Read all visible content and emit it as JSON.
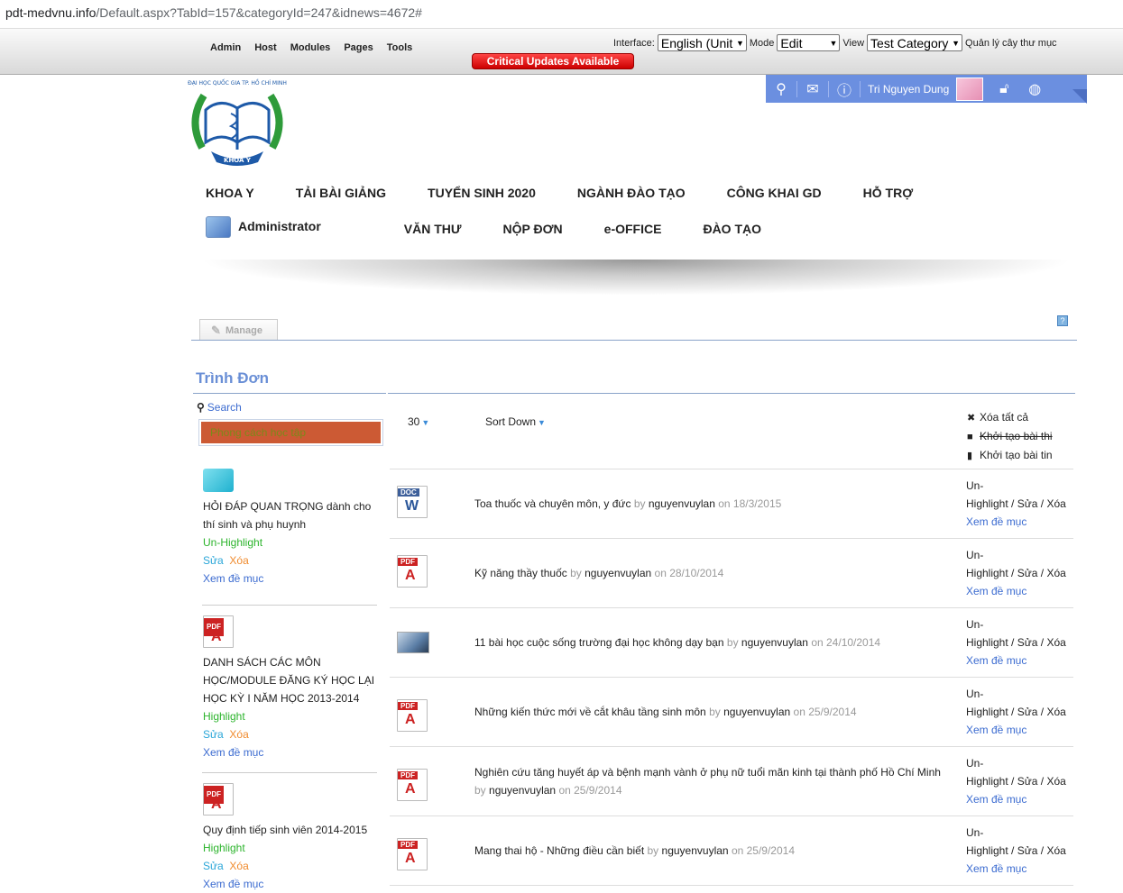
{
  "browser": {
    "url_host": "pdt-medvnu.info",
    "url_path": "/Default.aspx?TabId=157&categoryId=247&idnews=4672#"
  },
  "control_panel": {
    "menu": [
      "Admin",
      "Host",
      "Modules",
      "Pages",
      "Tools"
    ],
    "interface_label": "Interface:",
    "interface_value": "English (Unit",
    "mode_label": "Mode",
    "mode_value": "Edit",
    "view_label": "View",
    "view_value": "Test Category",
    "manage_folder": "Quản lý cây thư mục",
    "critical": "Critical Updates Available"
  },
  "user": {
    "name": "Tri Nguyen Dung"
  },
  "logo": {
    "top_text": "ĐẠI HỌC QUỐC GIA TP. HỒ CHÍ MINH",
    "bottom_text": "KHOA Y"
  },
  "nav": {
    "row1": [
      "KHOA Y",
      "TẢI BÀI GIẢNG",
      "TUYỂN SINH 2020",
      "NGÀNH ĐÀO TẠO",
      "CÔNG KHAI GD",
      "HỖ TRỢ"
    ],
    "row2_admin": "Administrator",
    "row2": [
      "VĂN THƯ",
      "NỘP ĐƠN",
      "e-OFFICE",
      "ĐÀO TẠO"
    ]
  },
  "manage_label": "Manage",
  "pane_title": "Trình Đơn",
  "search_label": "Search",
  "category": "Phong cách học tập",
  "left_items": [
    {
      "title": "HỎI ĐÁP QUAN TRỌNG dành cho thí sinh và phụ huynh",
      "hl": "Un-Highlight",
      "sua": "Sửa",
      "xoa": "Xóa",
      "xem": "Xem đề mục",
      "icon": "cyan"
    },
    {
      "title": "DANH SÁCH CÁC MÔN HỌC/MODULE ĐĂNG KÝ HỌC LẠI HỌC KỲ I NĂM HỌC 2013-2014",
      "hl": "Highlight",
      "sua": "Sửa",
      "xoa": "Xóa",
      "xem": "Xem đề mục",
      "icon": "pdf"
    },
    {
      "title": "Quy định tiếp sinh viên 2014-2015",
      "hl": "Highlight",
      "sua": "Sửa",
      "xoa": "Xóa",
      "xem": "Xem đề mục",
      "icon": "pdf"
    }
  ],
  "toolbar": {
    "page_size": "30",
    "sort": "Sort Down",
    "act1": "Xóa tất cả",
    "act2": "Khởi tạo bài thi",
    "act3": "Khởi tạo bài tin"
  },
  "rows": [
    {
      "icon": "doc",
      "title": "Toa thuốc và chuyên môn, y đức",
      "by": "by",
      "author": "nguyenvuylan",
      "on": "on 18/3/2015"
    },
    {
      "icon": "pdf",
      "title": "Kỹ năng thầy thuốc",
      "by": "by",
      "author": "nguyenvuylan",
      "on": "on 28/10/2014"
    },
    {
      "icon": "photo",
      "title": "11 bài học cuộc sống trường đại học không dạy bạn",
      "by": "by",
      "author": "nguyenvuylan",
      "on": "on 24/10/2014"
    },
    {
      "icon": "pdf",
      "title": "Những kiến thức mới về cắt khâu tầng sinh môn",
      "by": "by",
      "author": "nguyenvuylan",
      "on": "on 25/9/2014"
    },
    {
      "icon": "pdf",
      "title": "Nghiên cứu tăng huyết áp và bệnh mạnh vành ở phụ nữ tuổi mãn kinh tại thành phố Hồ Chí Minh",
      "by": "by",
      "author": "nguyenvuylan",
      "on": "on 25/9/2014"
    },
    {
      "icon": "pdf",
      "title": "Mang thai hộ - Những điều cần biết",
      "by": "by",
      "author": "nguyenvuylan",
      "on": "on 25/9/2014"
    }
  ],
  "row_actions": {
    "un": "Un-",
    "highlight": "Highlight",
    "slash": " / ",
    "sua": "Sửa",
    "xoa": "Xóa",
    "xem": "Xem đề mục"
  },
  "icon_text": {
    "pdf_tag": "PDF",
    "pdf_mark": "A",
    "doc_tag": "DOC",
    "doc_mark": "W",
    "help": "?"
  }
}
